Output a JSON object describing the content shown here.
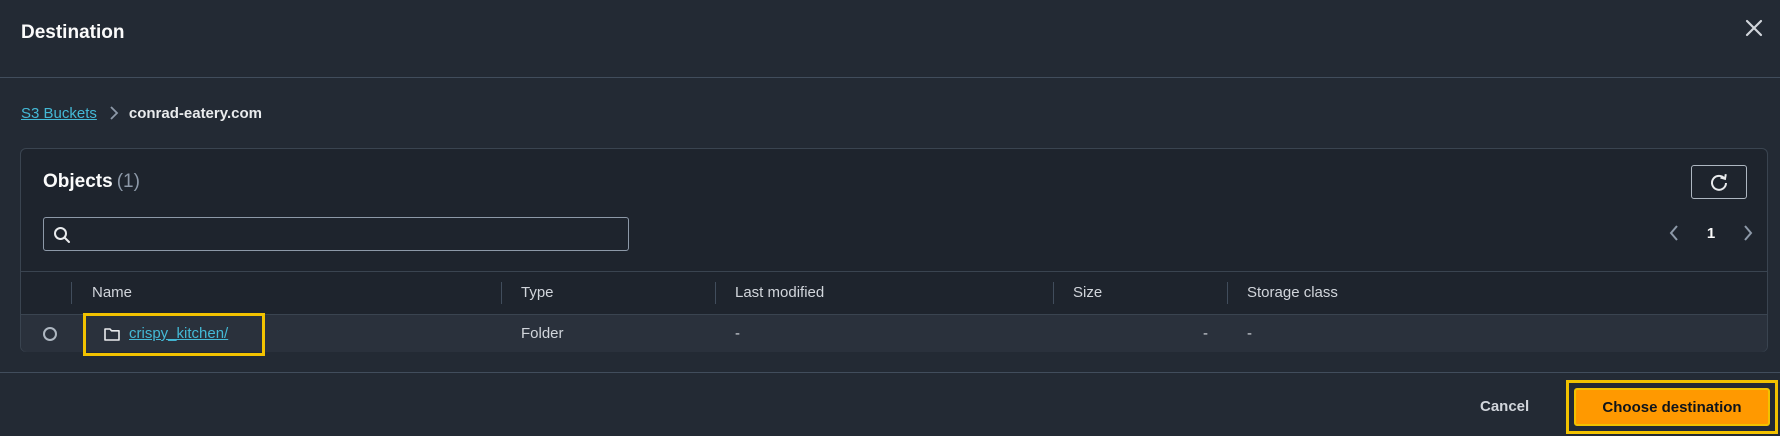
{
  "modal": {
    "title": "Destination"
  },
  "breadcrumb": {
    "root": "S3 Buckets",
    "current": "conrad-eatery.com"
  },
  "objects": {
    "title": "Objects",
    "count": "(1)",
    "search": {
      "placeholder": "",
      "value": ""
    },
    "pagination": {
      "page": "1"
    },
    "columns": [
      "Name",
      "Type",
      "Last modified",
      "Size",
      "Storage class"
    ],
    "rows": [
      {
        "name": "crispy_kitchen/",
        "type": "Folder",
        "last_modified": "-",
        "size": "-",
        "storage_class": "-"
      }
    ]
  },
  "footer": {
    "cancel_label": "Cancel",
    "choose_label": "Choose destination"
  },
  "colors": {
    "accent": "#ff9900",
    "link": "#44b9d6",
    "highlight": "#f2c200",
    "background": "#232a34"
  },
  "icons": [
    "close-icon",
    "chevron-right-icon",
    "refresh-icon",
    "search-icon",
    "chevron-left-icon",
    "folder-icon"
  ]
}
